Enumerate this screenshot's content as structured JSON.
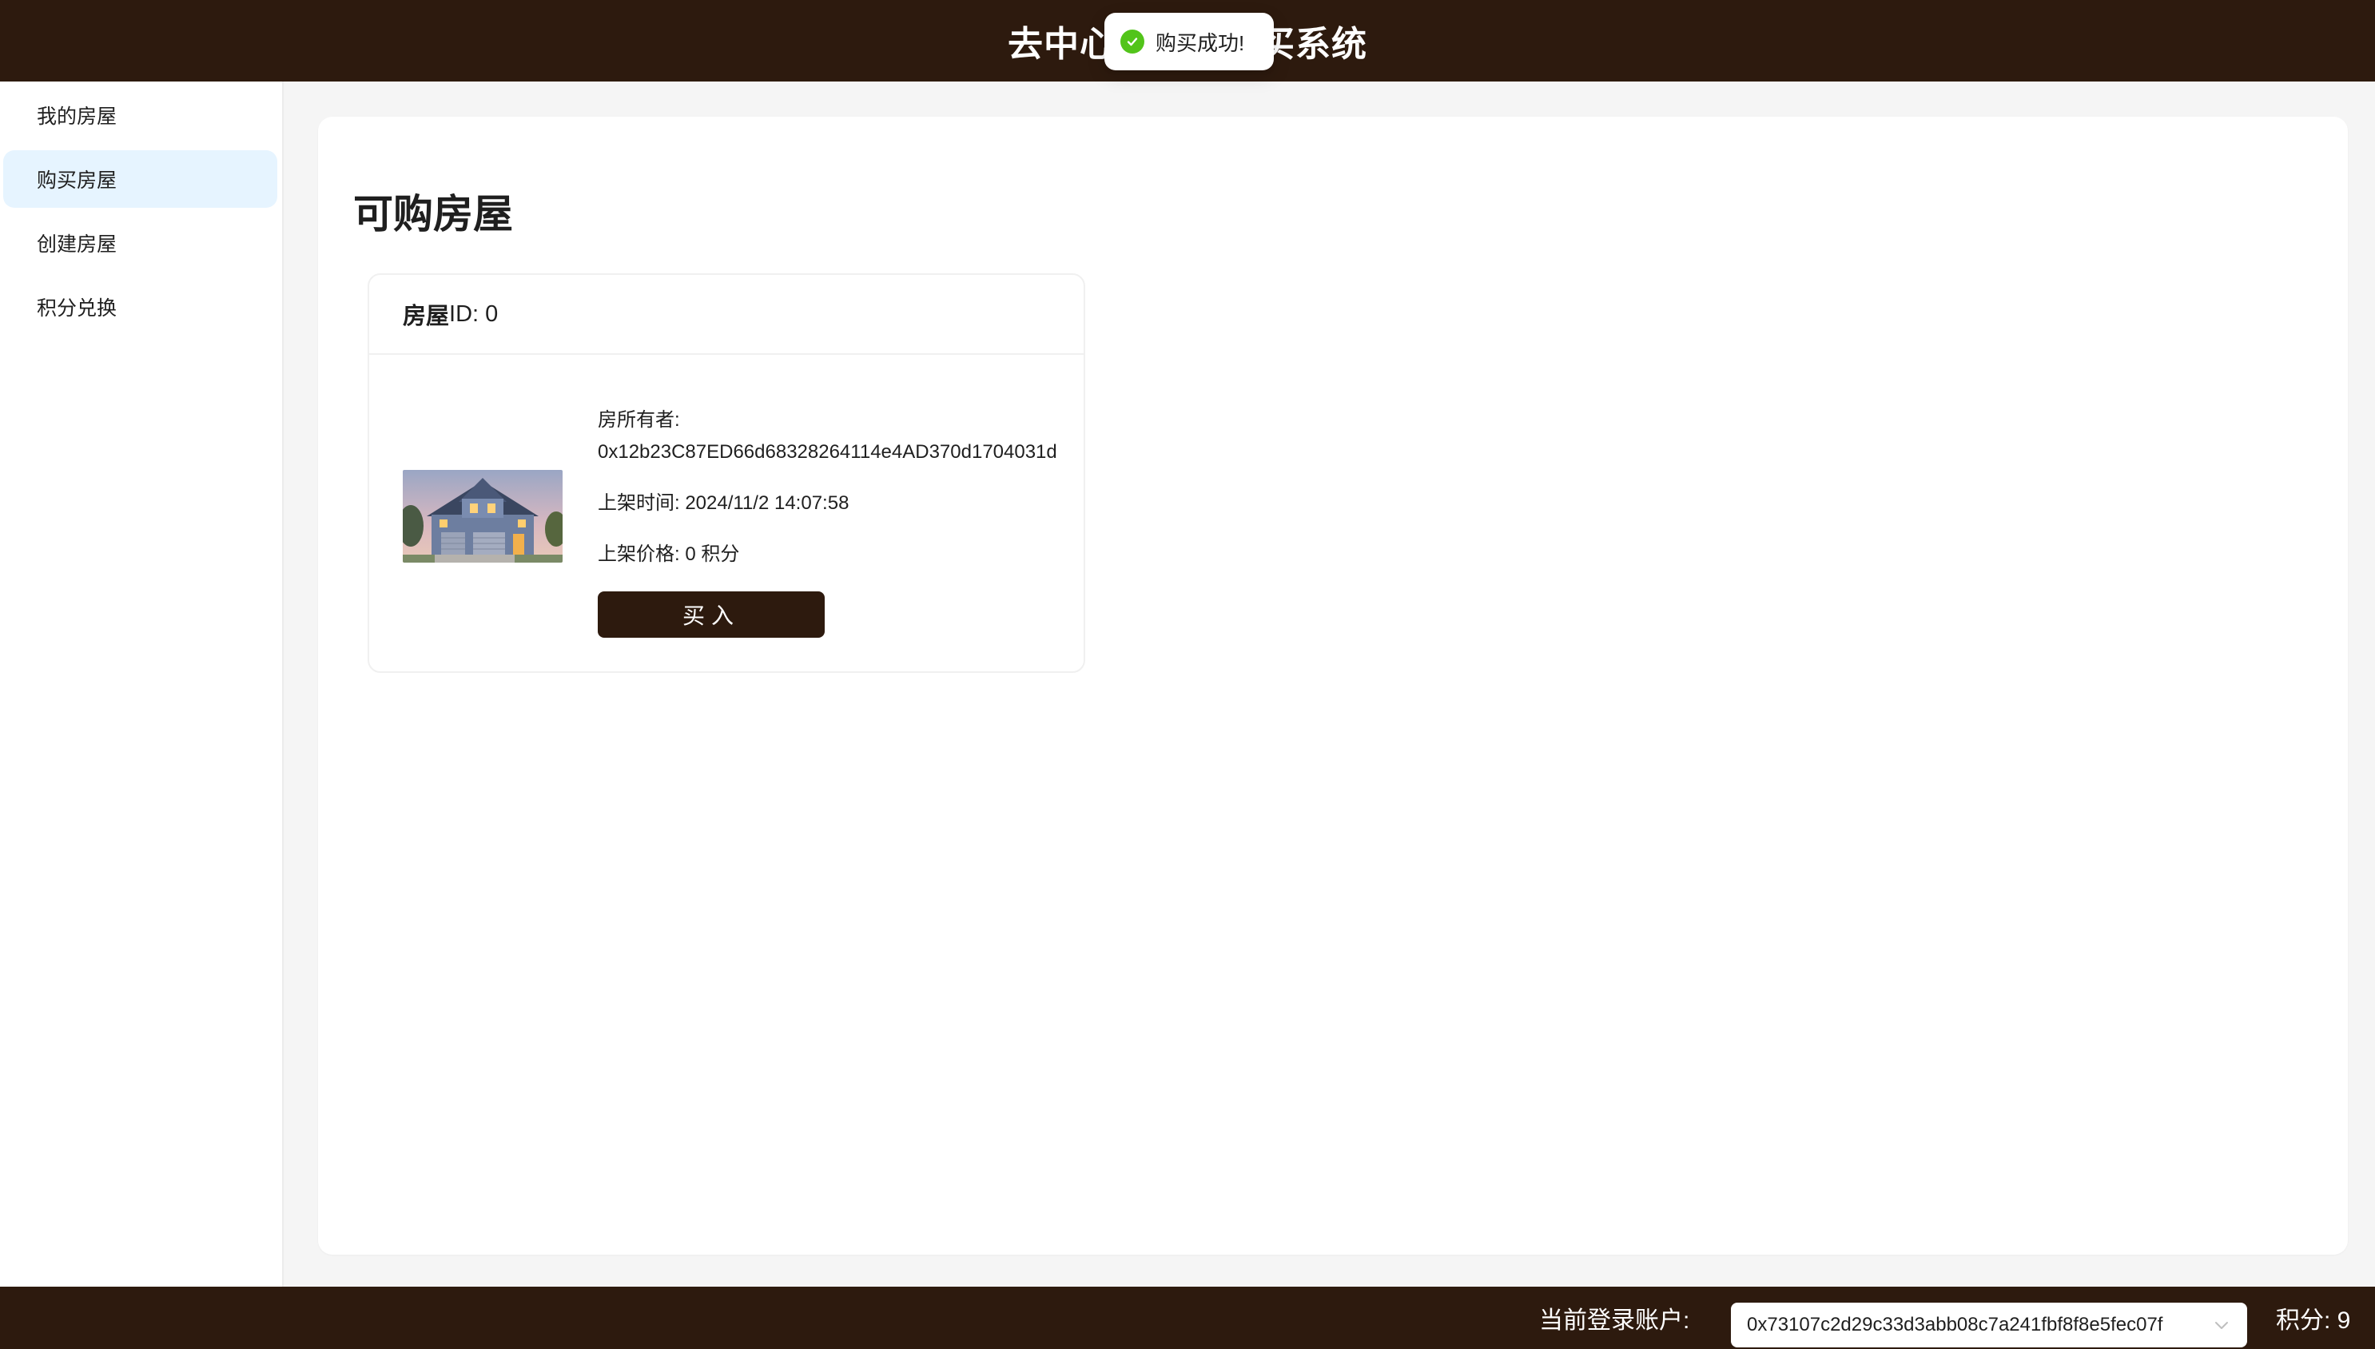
{
  "header": {
    "title": "去中心化房屋购买系统"
  },
  "toast": {
    "message": "购买成功!",
    "icon": "check-circle-icon",
    "color": "#52c41a"
  },
  "sidebar": {
    "items": [
      {
        "label": "我的房屋",
        "active": false
      },
      {
        "label": "购买房屋",
        "active": true
      },
      {
        "label": "创建房屋",
        "active": false
      },
      {
        "label": "积分兑换",
        "active": false
      }
    ]
  },
  "main": {
    "title": "可购房屋",
    "houses": [
      {
        "id_label": "房屋",
        "id_suffix": "ID: 0",
        "owner_label": "房所有者:",
        "owner_address": "0x12b23C87ED66d68328264114e4AD370d1704031d",
        "listed_time": "上架时间: 2024/11/2 14:07:58",
        "listed_price": "上架价格: 0 积分",
        "buy_label": "买入",
        "image_icon": "house-image"
      }
    ]
  },
  "footer": {
    "account_label": "当前登录账户:",
    "account_value": "0x73107c2d29c33d3abb08c7a241fbf8f8e5fec07f",
    "points": "积分: 9"
  },
  "colors": {
    "brand_dark": "#2d1a0e",
    "active_bg": "#e6f4ff"
  }
}
